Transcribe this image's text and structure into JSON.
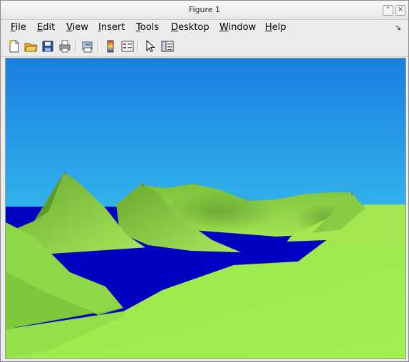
{
  "window": {
    "title": "Figure 1",
    "title_buttons": [
      "⌃",
      "▢",
      "✕"
    ]
  },
  "menu": {
    "items": [
      {
        "key": "F",
        "rest": "ile"
      },
      {
        "key": "E",
        "rest": "dit"
      },
      {
        "key": "V",
        "rest": "iew"
      },
      {
        "key": "I",
        "rest": "nsert"
      },
      {
        "key": "T",
        "rest": "ools"
      },
      {
        "key": "D",
        "rest": "esktop"
      },
      {
        "key": "W",
        "rest": "indow"
      },
      {
        "key": "H",
        "rest": "elp"
      }
    ],
    "dock_glyph": "↘"
  },
  "toolbar": {
    "icons": [
      "new-file-icon",
      "open-folder-icon",
      "save-icon",
      "print-icon",
      "print-preview-icon",
      "colorbar-icon",
      "legend-icon",
      "pointer-icon",
      "property-editor-icon"
    ]
  },
  "scene": {
    "sky_top": "#1a7fe0",
    "sky_bottom": "#4ae6fa",
    "water": "#0000c0",
    "terrain_light": "#a9f64c",
    "terrain_dark": "#5e9c2c"
  }
}
